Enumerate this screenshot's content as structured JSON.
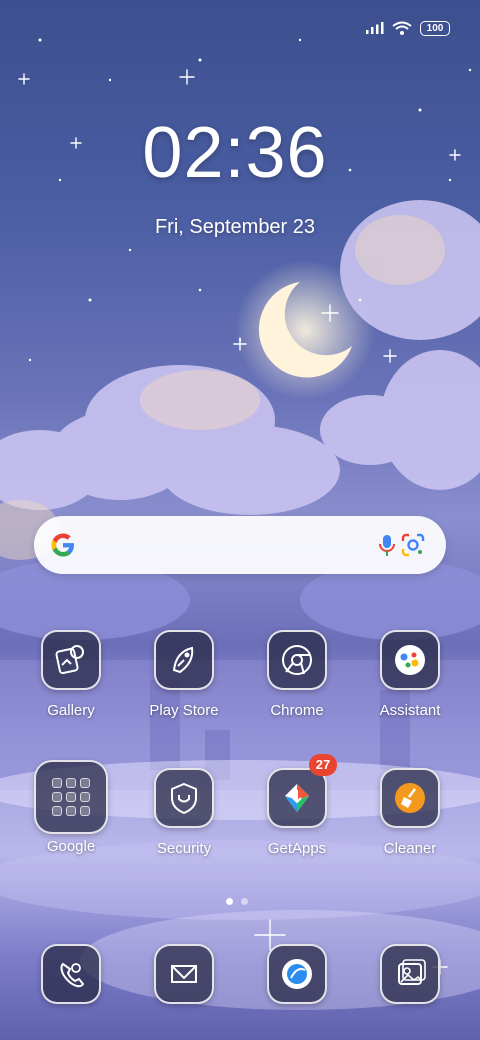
{
  "status_bar": {
    "battery": "100",
    "icons": [
      "signal-icon",
      "wifi-icon",
      "battery-icon"
    ]
  },
  "clock": {
    "time": "02:36",
    "date": "Fri, September 23"
  },
  "search_bar": {
    "icons": [
      "google-logo-icon",
      "microphone-icon",
      "google-lens-icon"
    ]
  },
  "apps": {
    "row1": [
      {
        "label": "Gallery",
        "icon": "gallery-icon"
      },
      {
        "label": "Play Store",
        "icon": "play-store-icon"
      },
      {
        "label": "Chrome",
        "icon": "chrome-icon"
      },
      {
        "label": "Assistant",
        "icon": "assistant-icon"
      }
    ],
    "row2": [
      {
        "label": "Google",
        "icon": "google-folder-icon"
      },
      {
        "label": "Security",
        "icon": "shield-icon"
      },
      {
        "label": "GetApps",
        "icon": "getapps-icon",
        "badge": "27"
      },
      {
        "label": "Cleaner",
        "icon": "broom-icon"
      }
    ]
  },
  "dock": [
    {
      "icon": "phone-icon"
    },
    {
      "icon": "messages-icon"
    },
    {
      "icon": "browser-icon"
    },
    {
      "icon": "gallery-photo-icon"
    }
  ],
  "page_indicator": {
    "pages": 2,
    "active": 1
  },
  "colors": {
    "badge": "#e8442f",
    "icon_bg": "#282a46",
    "sky_top": "#3c4f8e"
  }
}
